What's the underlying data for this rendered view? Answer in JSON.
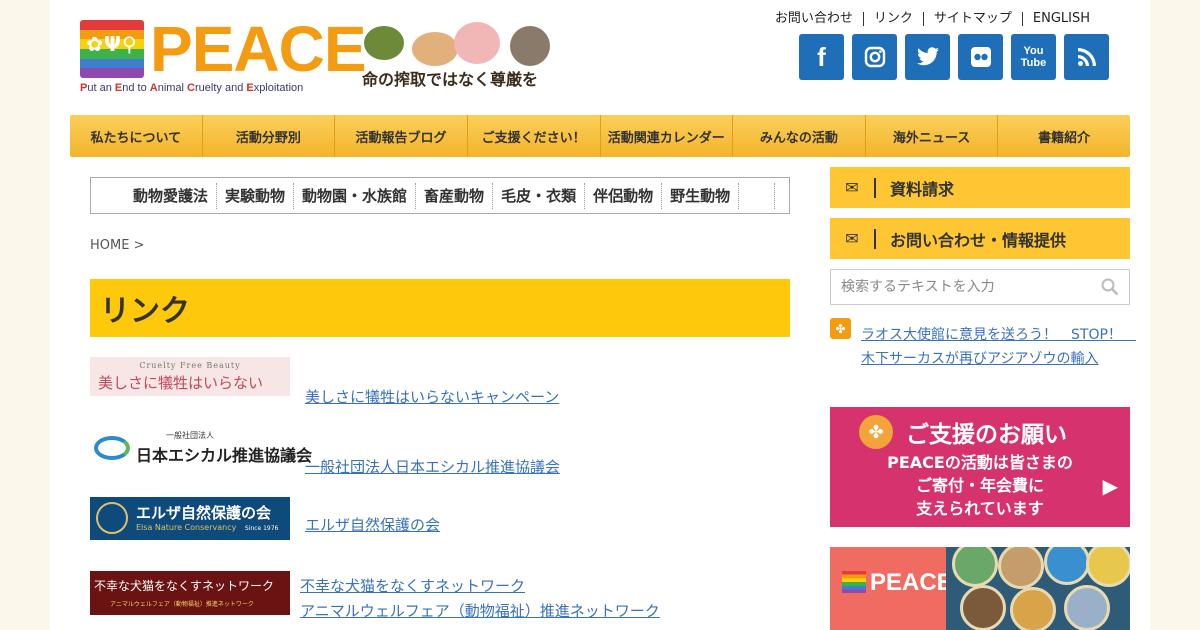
{
  "header": {
    "logo_word": "PEACE",
    "logo_tagline_parts": [
      "P",
      "ut an ",
      "E",
      "nd to ",
      "A",
      "nimal ",
      "C",
      "ruelty and ",
      "E",
      "xploitation"
    ],
    "banner_text": "命の搾取ではなく尊厳を",
    "top_links": [
      "お問い合わせ",
      "リンク",
      "サイトマップ",
      "ENGLISH"
    ],
    "social": [
      {
        "icon": "facebook-icon",
        "glyph": "f"
      },
      {
        "icon": "instagram-icon",
        "glyph": "◎"
      },
      {
        "icon": "twitter-icon",
        "glyph": "🐦"
      },
      {
        "icon": "flickr-icon",
        "glyph": "●●"
      },
      {
        "icon": "youtube-icon",
        "glyph": "You Tube"
      },
      {
        "icon": "rss-icon",
        "glyph": "◔"
      }
    ]
  },
  "main_nav": [
    "私たちについて",
    "活動分野別",
    "活動報告ブログ",
    "ご支援ください！",
    "活動関連カレンダー",
    "みんなの活動",
    "海外ニュース",
    "書籍紹介"
  ],
  "sub_nav": [
    "動物愛護法",
    "実験動物",
    "動物園・水族館",
    "畜産動物",
    "毛皮・衣類",
    "伴侶動物",
    "野生動物"
  ],
  "breadcrumb": "HOME >",
  "page_title": "リンク",
  "links": [
    {
      "image_caption_top": "Cruelty Free Beauty",
      "image_caption_main": "美しさに犠牲はいらない",
      "label": "美しさに犠牲はいらないキャンペーン"
    },
    {
      "image_caption_top": "一般社団法人",
      "image_caption_main": "日本エシカル推進協議会",
      "label": "一般社団法人日本エシカル推進協議会"
    },
    {
      "image_caption_top": "エルザ自然保護の会",
      "image_caption_main": "Elsa Nature Conservancy",
      "image_caption_since": "Since 1976",
      "label": "エルザ自然保護の会"
    },
    {
      "image_caption_top": "不幸な犬猫をなくすネットワーク",
      "image_caption_main": "アニマルウェルフェア（動物福祉）推進ネットワーク",
      "label": "不幸な犬猫をなくすネットワーク",
      "label2": "アニマルウェルフェア（動物福祉）推進ネットワーク"
    }
  ],
  "sidebar": {
    "request_docs": "資料請求",
    "contact": "お問い合わせ・情報提供",
    "search_placeholder": "検索するテキストを入力",
    "news_link": "ラオス大使館に意見を送ろう！　STOP！　木下サーカスが再びアジアゾウの輸入",
    "support_title": "ご支援のお願い",
    "support_line1": "PEACEの活動は皆さまの",
    "support_line2": "ご寄付・年会費に",
    "support_line3": "支えられています",
    "merch_brand": "PEACE"
  },
  "colors": {
    "accent_yellow": "#fec80b",
    "nav_orange": "#f3b42b",
    "social_blue": "#1e6fb8",
    "link_blue": "#3a72b8",
    "support_pink": "#d6336e"
  }
}
